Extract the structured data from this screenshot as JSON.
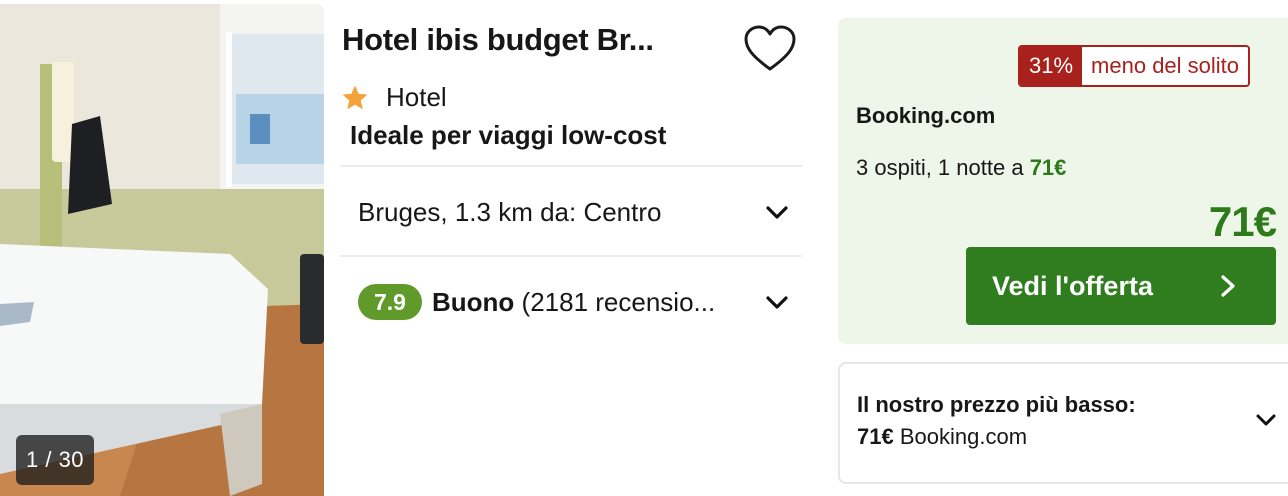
{
  "photo": {
    "counter": "1 / 30"
  },
  "hotel": {
    "name": "Hotel ibis budget Br...",
    "type": "Hotel",
    "stars": 1,
    "tagline": "Ideale per viaggi low-cost",
    "location": "Bruges, 1.3 km da: Centro",
    "rating": {
      "score": "7.9",
      "label": "Buono",
      "reviews": "(2181 recensio..."
    }
  },
  "deal": {
    "discount_percent": "31%",
    "discount_label": "meno del solito",
    "provider": "Booking.com",
    "stay_prefix": "3 ospiti, 1 notte a",
    "stay_price": "71€",
    "price": "71€",
    "cta_label": "Vedi l'offerta"
  },
  "lowest_price": {
    "title": "Il nostro prezzo più basso:",
    "price": "71€",
    "provider": "Booking.com"
  },
  "colors": {
    "accent_green": "#2f7d1e",
    "score_green": "#5f9a2b",
    "deal_bg": "#eef5e9",
    "discount_red": "#a8211c",
    "star_orange": "#f4a23a"
  },
  "icons": {
    "favorite": "heart-outline-icon",
    "star": "star-icon",
    "expand": "chevron-down-icon",
    "cta": "chevron-right-icon"
  }
}
